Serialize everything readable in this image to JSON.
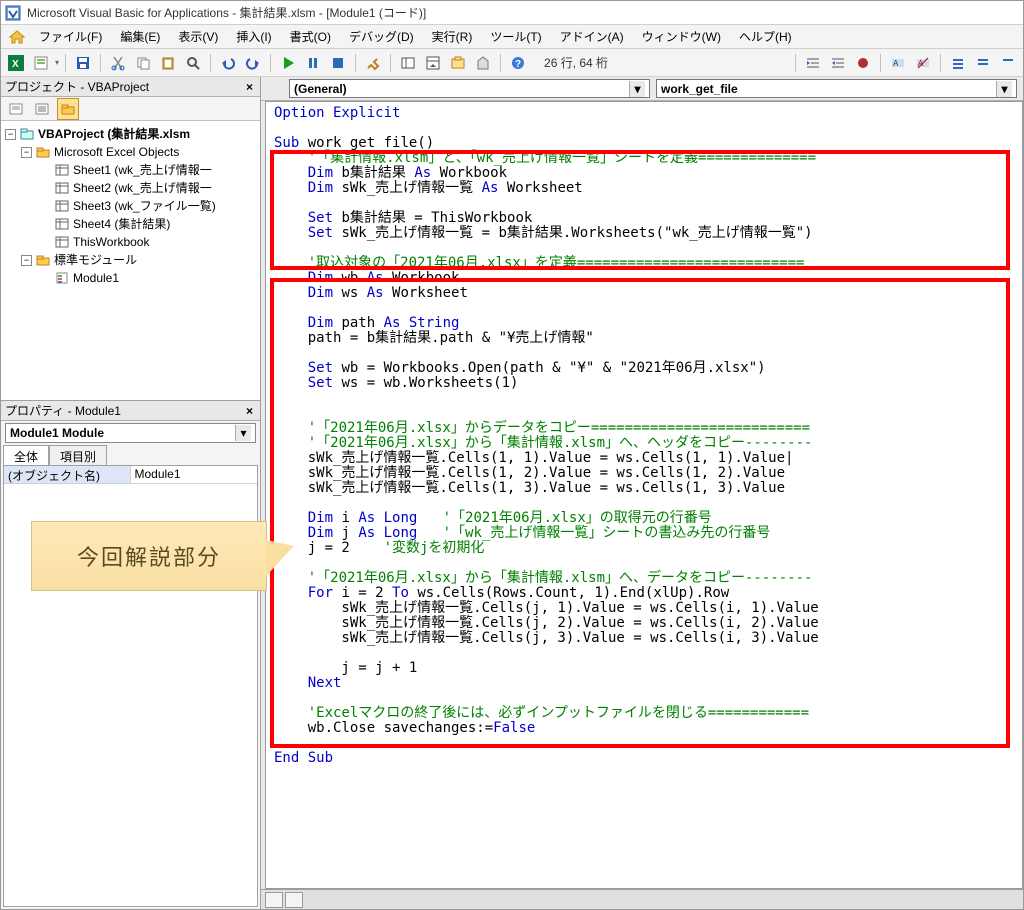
{
  "title": "Microsoft Visual Basic for Applications - 集計結果.xlsm - [Module1 (コード)]",
  "menus": {
    "file": "ファイル(F)",
    "edit": "編集(E)",
    "view": "表示(V)",
    "insert": "挿入(I)",
    "format": "書式(O)",
    "debug": "デバッグ(D)",
    "run": "実行(R)",
    "tools": "ツール(T)",
    "addins": "アドイン(A)",
    "window": "ウィンドウ(W)",
    "help": "ヘルプ(H)"
  },
  "cursor_position": "26 行, 64 桁",
  "project_pane": {
    "title": "プロジェクト - VBAProject",
    "root": "VBAProject (集計結果.xlsm",
    "objects_folder": "Microsoft Excel Objects",
    "sheet1": "Sheet1 (wk_売上げ情報一",
    "sheet2": "Sheet2 (wk_売上げ情報一",
    "sheet3": "Sheet3 (wk_ファイル一覧)",
    "sheet4": "Sheet4 (集計結果)",
    "thiswb": "ThisWorkbook",
    "mod_folder": "標準モジュール",
    "module1": "Module1"
  },
  "properties_pane": {
    "title": "プロパティ - Module1",
    "object_combo": "Module1  Module",
    "tab_all": "全体",
    "tab_cat": "項目別",
    "prop_name_label": "(オブジェクト名)",
    "prop_name_value": "Module1"
  },
  "callout_text": "今回解説部分",
  "dropdowns": {
    "left": "(General)",
    "right": "work_get_file"
  },
  "code": {
    "l1_opt": "Option Explicit",
    "l3_sub": "Sub",
    "l3_name": " work_get_file()",
    "l4_cm": "    '「集計情報.xlsm」と、「wk_売上げ情報一覧」シートを定義==============",
    "l5a": "    Dim",
    "l5b": " b集計結果 ",
    "l5c": "As",
    "l5d": " Workbook",
    "l6a": "    Dim",
    "l6b": " sWk_売上げ情報一覧 ",
    "l6c": "As",
    "l6d": " Worksheet",
    "l8a": "    Set",
    "l8b": " b集計結果 = ThisWorkbook",
    "l9a": "    Set",
    "l9b": " sWk_売上げ情報一覧 = b集計結果.Worksheets(\"wk_売上げ情報一覧\")",
    "l11_cm": "    '取込対象の「2021年06月.xlsx」を定義===========================",
    "l12a": "    Dim",
    "l12b": " wb ",
    "l12c": "As",
    "l12d": " Workbook",
    "l13a": "    Dim",
    "l13b": " ws ",
    "l13c": "As",
    "l13d": " Worksheet",
    "l15a": "    Dim",
    "l15b": " path ",
    "l15c": "As String",
    "l16": "    path = b集計結果.path & \"¥売上げ情報\"",
    "l18a": "    Set",
    "l18b": " wb = Workbooks.Open(path & \"¥\" & \"2021年06月.xlsx\")",
    "l19a": "    Set",
    "l19b": " ws = wb.Worksheets(1)",
    "l22_cm": "    '「2021年06月.xlsx」からデータをコピー==========================",
    "l23_cm": "    '「2021年06月.xlsx」から「集計情報.xlsm」へ、ヘッダをコピー--------",
    "l24": "    sWk_売上げ情報一覧.Cells(1, 1).Value = ws.Cells(1, 1).Value|",
    "l25": "    sWk_売上げ情報一覧.Cells(1, 2).Value = ws.Cells(1, 2).Value",
    "l26": "    sWk_売上げ情報一覧.Cells(1, 3).Value = ws.Cells(1, 3).Value",
    "l28a": "    Dim",
    "l28b": " i ",
    "l28c": "As Long",
    "l28d": "   '「2021年06月.xlsx」の取得元の行番号",
    "l29a": "    Dim",
    "l29b": " j ",
    "l29c": "As Long",
    "l29d": "   '「wk_売上げ情報一覧」シートの書込み先の行番号",
    "l30a": "    j = 2    ",
    "l30b": "'変数jを初期化",
    "l32_cm": "    '「2021年06月.xlsx」から「集計情報.xlsm」へ、データをコピー--------",
    "l33a": "    For",
    "l33b": " i = 2 ",
    "l33c": "To",
    "l33d": " ws.Cells(Rows.Count, 1).End(xlUp).Row",
    "l34": "        sWk_売上げ情報一覧.Cells(j, 1).Value = ws.Cells(i, 1).Value",
    "l35": "        sWk_売上げ情報一覧.Cells(j, 2).Value = ws.Cells(i, 2).Value",
    "l36": "        sWk_売上げ情報一覧.Cells(j, 3).Value = ws.Cells(i, 3).Value",
    "l38": "        j = j + 1",
    "l39": "    Next",
    "l41_cm": "    'Excelマクロの終了後には、必ずインプットファイルを閉じる============",
    "l42a": "    wb.Close savechanges:=",
    "l42b": "False",
    "l44": "End Sub"
  }
}
